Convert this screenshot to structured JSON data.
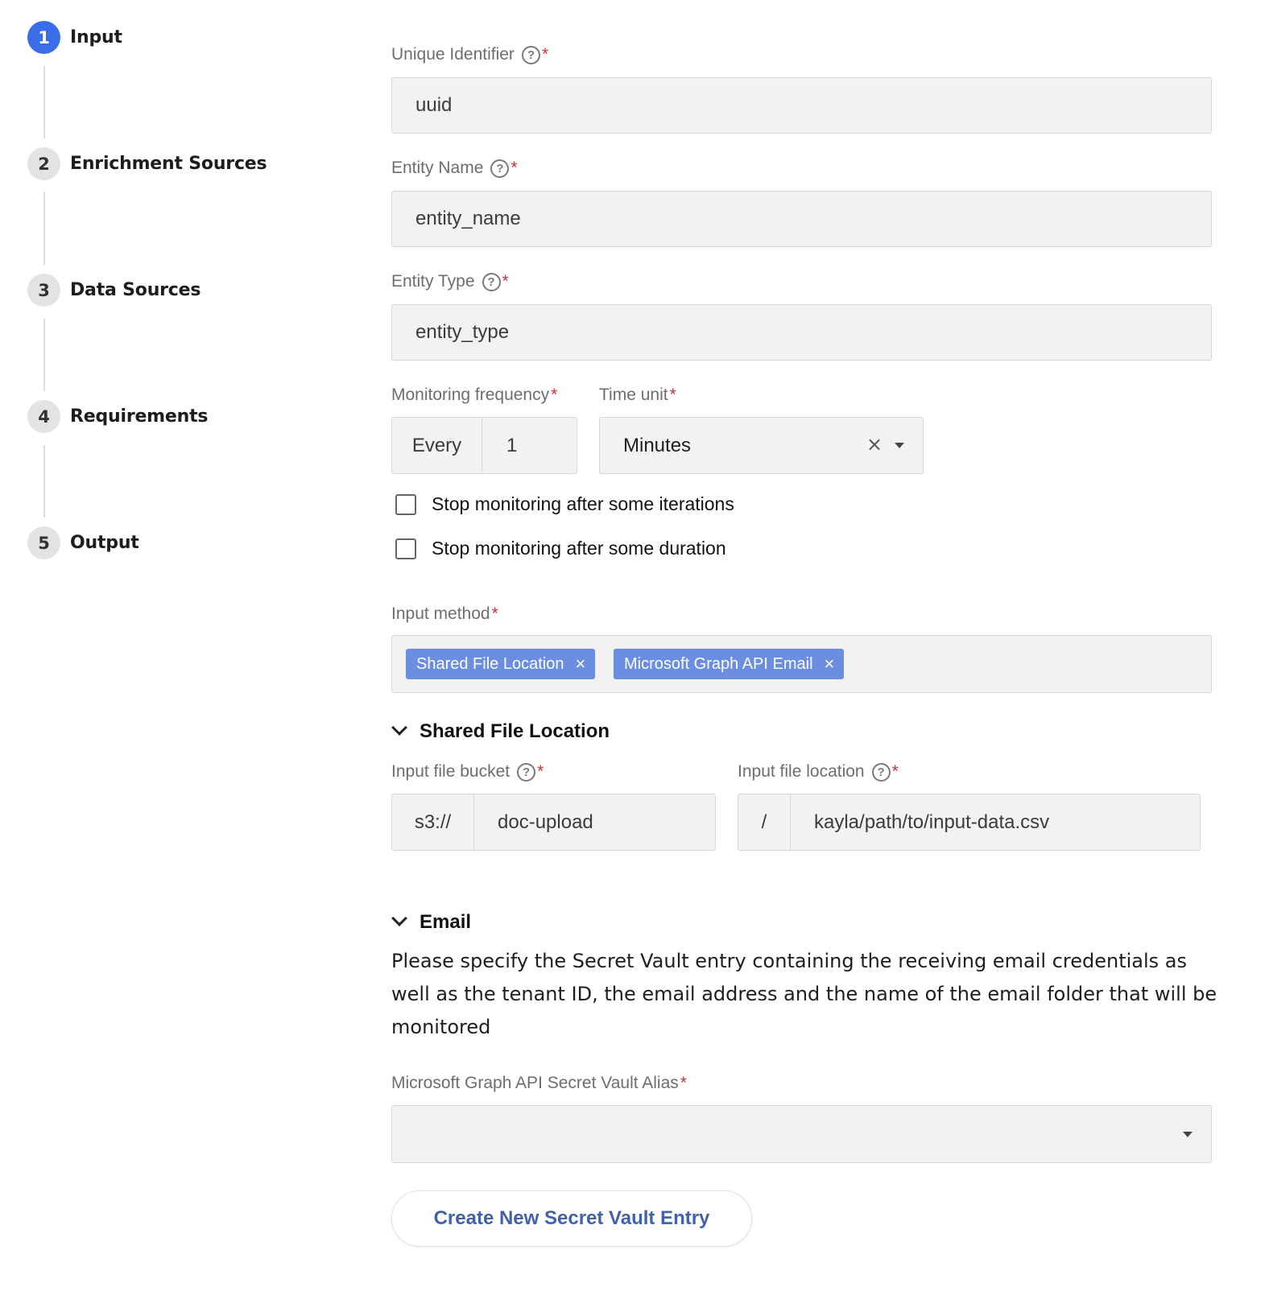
{
  "stepper": {
    "steps": [
      {
        "number": "1",
        "label": "Input"
      },
      {
        "number": "2",
        "label": "Enrichment Sources"
      },
      {
        "number": "3",
        "label": "Data Sources"
      },
      {
        "number": "4",
        "label": "Requirements"
      },
      {
        "number": "5",
        "label": "Output"
      }
    ],
    "active_step": "1",
    "active_color": "#3a6ee8"
  },
  "form": {
    "unique_identifier": {
      "label": "Unique Identifier",
      "required_mark": "*",
      "value": "uuid"
    },
    "entity_name": {
      "label": "Entity Name",
      "required_mark": "*",
      "value": "entity_name"
    },
    "entity_type": {
      "label": "Entity Type",
      "required_mark": "*",
      "value": "entity_type"
    },
    "monitoring_frequency": {
      "label": "Monitoring frequency",
      "required_mark": "*",
      "prefix": "Every",
      "value": "1"
    },
    "time_unit": {
      "label": "Time unit",
      "required_mark": "*",
      "value": "Minutes",
      "clear_icon": "×"
    },
    "stop_iterations": {
      "label": "Stop monitoring after some iterations",
      "checked": false
    },
    "stop_duration": {
      "label": "Stop monitoring after some duration",
      "checked": false
    },
    "input_method": {
      "label": "Input method",
      "required_mark": "*",
      "chips": [
        "Shared File Location",
        "Microsoft Graph API Email"
      ],
      "chip_remove": "×",
      "chip_color": "#6b8ee0"
    },
    "shared_file_location": {
      "title": "Shared File Location",
      "bucket": {
        "label": "Input file bucket",
        "required_mark": "*",
        "prefix": "s3://",
        "value": "doc-upload"
      },
      "location": {
        "label": "Input file location",
        "required_mark": "*",
        "prefix": "/",
        "value": "kayla/path/to/input-data.csv"
      }
    },
    "email": {
      "title": "Email",
      "description": "Please specify the Secret Vault entry containing the receiving email credentials as well as the tenant ID, the email address and the name of the email folder that will be monitored",
      "vault_alias": {
        "label": "Microsoft Graph API Secret Vault Alias",
        "required_mark": "*",
        "value": ""
      },
      "create_button": "Create New Secret Vault Entry"
    },
    "help_glyph": "?",
    "required_color": "#c43636"
  }
}
